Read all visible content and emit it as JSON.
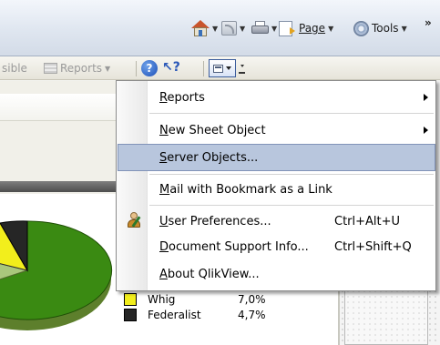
{
  "ie_toolbar": {
    "home_icon": "home-icon",
    "feeds_icon": "feeds-icon",
    "print_icon": "print-icon",
    "page_label": "Page",
    "tools_label": "Tools",
    "overflow": "»"
  },
  "qv_toolbar": {
    "partial_label": "sible",
    "reports_label": "Reports",
    "help_icon": "help-icon",
    "whats_this_icon": "whats-this-icon",
    "window_menu_icon": "window-menu-icon"
  },
  "context_menu": {
    "items": [
      {
        "label": "Reports",
        "accel": "R",
        "shortcut": "",
        "submenu": true
      },
      {
        "label": "New Sheet Object",
        "accel": "N",
        "shortcut": "",
        "submenu": true
      },
      {
        "label": "Server Objects...",
        "accel": "S",
        "shortcut": "",
        "submenu": false,
        "highlighted": true
      },
      {
        "label": "Mail with Bookmark as a Link",
        "accel": "M",
        "shortcut": "",
        "submenu": false
      },
      {
        "label": "User Preferences...",
        "accel": "U",
        "shortcut": "Ctrl+Alt+U",
        "submenu": false,
        "icon": "user-preferences-icon"
      },
      {
        "label": "Document Support Info...",
        "accel": "D",
        "shortcut": "Ctrl+Shift+Q",
        "submenu": false
      },
      {
        "label": "About QlikView...",
        "accel": "A",
        "shortcut": "",
        "submenu": false
      }
    ]
  },
  "legend": {
    "entries": [
      {
        "name": "Whig",
        "value": "7,0%",
        "color": "#f2ee1c"
      },
      {
        "name": "Federalist",
        "value": "4,7%",
        "color": "#262626"
      }
    ]
  },
  "colors": {
    "menu_highlight": "#b8c6dd",
    "pie_main": "#3a8a12",
    "pie_light": "#a9c77c"
  }
}
